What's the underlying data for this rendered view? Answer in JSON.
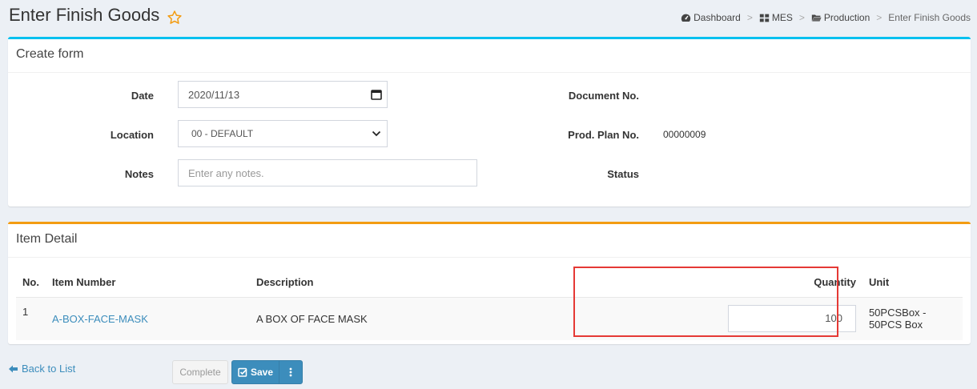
{
  "header": {
    "title": "Enter Finish Goods",
    "breadcrumb": [
      "Dashboard",
      "MES",
      "Production",
      "Enter Finish Goods"
    ]
  },
  "create_form": {
    "title": "Create form",
    "date_label": "Date",
    "date_value": "2020/11/13",
    "location_label": "Location",
    "location_value": "00 - DEFAULT",
    "notes_label": "Notes",
    "notes_placeholder": "Enter any notes.",
    "document_no_label": "Document No.",
    "prod_plan_label": "Prod. Plan No.",
    "prod_plan_value": "00000009",
    "status_label": "Status"
  },
  "item_detail": {
    "title": "Item Detail",
    "columns": {
      "no": "No.",
      "item_number": "Item Number",
      "description": "Description",
      "quantity": "Quantity",
      "unit": "Unit"
    },
    "rows": [
      {
        "no": "1",
        "item_number": "A-BOX-FACE-MASK",
        "description": "A BOX OF FACE MASK",
        "quantity": "100",
        "unit": "50PCSBox - 50PCS Box"
      }
    ]
  },
  "footer": {
    "back_label": "Back to List",
    "complete_label": "Complete",
    "save_label": "Save"
  },
  "colors": {
    "info_border": "#00c0ef",
    "warning_border": "#f39c12",
    "primary": "#3c8dbc",
    "highlight": "#e53935",
    "star": "#f39c12"
  }
}
